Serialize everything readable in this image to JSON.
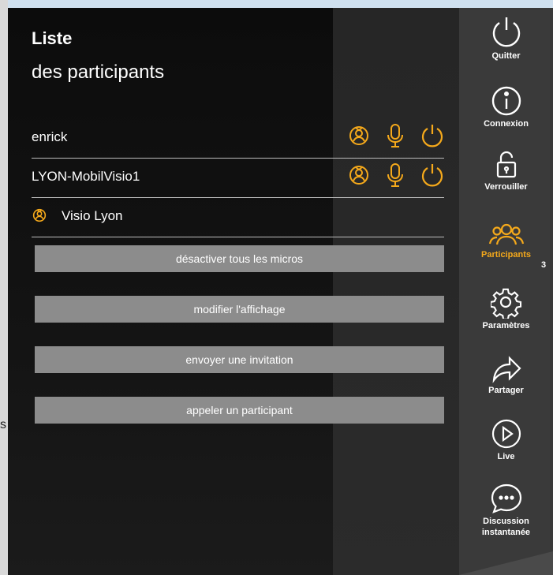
{
  "panel": {
    "title": "Liste",
    "subtitle": "des participants",
    "participants": [
      {
        "name": "enrick",
        "icons": [
          "participant-icon",
          "microphone-icon",
          "power-icon"
        ]
      },
      {
        "name": "LYON-MobilVisio1",
        "icons": [
          "participant-icon",
          "microphone-icon",
          "power-icon"
        ]
      },
      {
        "name": "Visio Lyon",
        "lead_icon": "participant-icon"
      }
    ],
    "buttons": [
      "désactiver tous les micros",
      "modifier l'affichage",
      "envoyer une invitation",
      "appeler un participant"
    ]
  },
  "stray_text": "s",
  "sidebar": {
    "items": [
      {
        "label": "Quitter",
        "icon": "power-icon"
      },
      {
        "label": "Connexion",
        "icon": "info-icon"
      },
      {
        "label": "Verrouiller",
        "icon": "lock-icon"
      },
      {
        "label": "Participants",
        "icon": "participants-icon",
        "count": "3",
        "active": true
      },
      {
        "label": "Paramètres",
        "icon": "gear-icon"
      },
      {
        "label": "Partager",
        "icon": "share-arrow-icon"
      },
      {
        "label": "Live",
        "icon": "play-icon"
      },
      {
        "label": "Discussion instantanée",
        "icon": "chat-bubble-icon"
      }
    ]
  },
  "colors": {
    "accent": "#f5a91b",
    "button_bg": "#8c8c8c",
    "sidebar_bg": "#3a3a3a",
    "text": "#ffffff"
  }
}
